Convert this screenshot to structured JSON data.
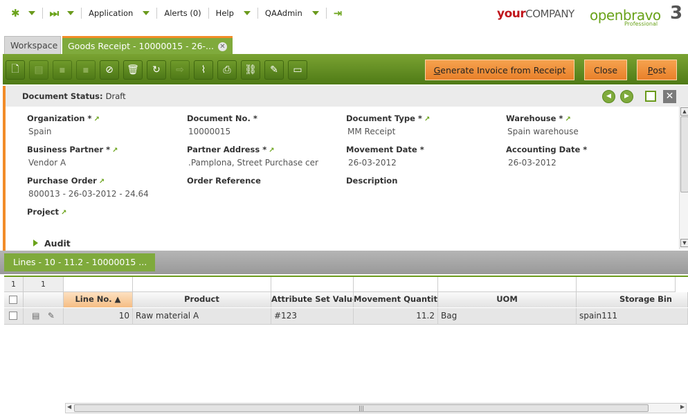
{
  "nav": {
    "application": "Application",
    "alerts": "Alerts (0)",
    "help": "Help",
    "user": "QAAdmin"
  },
  "brand": {
    "your": "your",
    "company": "COMPANY",
    "openbravo": "openbravo",
    "version": "3",
    "edition": "Professional"
  },
  "tabs": {
    "workspace": "Workspace",
    "goods_receipt": "Goods Receipt - 10000015 - 26-..."
  },
  "toolbar": {
    "generate_invoice_first": "G",
    "generate_invoice_rest": "enerate Invoice from Receipt",
    "close": "Close",
    "post_first": "P",
    "post_rest": "ost"
  },
  "form": {
    "status_label": "Document Status:",
    "status_value": "Draft",
    "fields": {
      "organization": {
        "label": "Organization *",
        "value": "Spain"
      },
      "document_no": {
        "label": "Document No. *",
        "value": "10000015"
      },
      "document_type": {
        "label": "Document Type *",
        "value": "MM Receipt"
      },
      "warehouse": {
        "label": "Warehouse *",
        "value": "Spain warehouse"
      },
      "business_partner": {
        "label": "Business Partner *",
        "value": "Vendor A"
      },
      "partner_address": {
        "label": "Partner Address *",
        "value": ".Pamplona, Street Purchase cer"
      },
      "movement_date": {
        "label": "Movement Date *",
        "value": "26-03-2012"
      },
      "accounting_date": {
        "label": "Accounting Date *",
        "value": "26-03-2012"
      },
      "purchase_order": {
        "label": "Purchase Order",
        "value": "800013 - 26-03-2012 - 24.64"
      },
      "order_reference": {
        "label": "Order Reference",
        "value": ""
      },
      "description": {
        "label": "Description",
        "value": ""
      },
      "project": {
        "label": "Project",
        "value": ""
      }
    },
    "audit": "Audit"
  },
  "lines": {
    "tab_label": "Lines - 10 - 11.2 - 10000015 ...",
    "count_a": "1",
    "count_b": "1",
    "columns": [
      "Line No.",
      "Product",
      "Attribute Set Value",
      "Movement Quantity",
      "UOM",
      "Storage Bin"
    ],
    "sort_indicator": "▲",
    "rows": [
      {
        "line_no": "10",
        "product": "Raw material A",
        "attribute_set_value": "#123",
        "movement_quantity": "11.2",
        "uom": "Bag",
        "storage_bin": "spain111"
      }
    ]
  },
  "icons": {
    "nav": [
      "asterisk-icon",
      "fast-forward-icon",
      "logout-icon"
    ],
    "toolbar": [
      "new-document-icon",
      "new-row-icon",
      "save-icon",
      "save-close-icon",
      "undo-icon",
      "delete-icon",
      "refresh-icon",
      "export-icon",
      "attachment-icon",
      "print-icon",
      "link-icon",
      "tools-icon",
      "grid-view-icon"
    ]
  }
}
